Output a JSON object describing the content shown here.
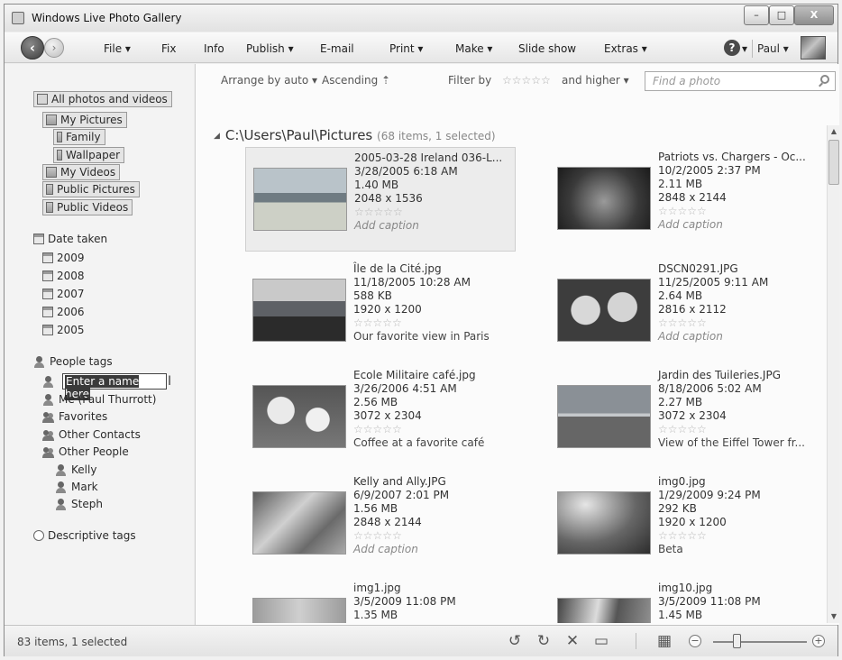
{
  "window": {
    "title": "Windows Live Photo Gallery",
    "min": "–",
    "max": "□",
    "close": "X"
  },
  "menubar": {
    "items": [
      {
        "label": "File ▾"
      },
      {
        "label": "Fix"
      },
      {
        "label": "Info"
      },
      {
        "label": "Publish ▾"
      },
      {
        "label": "E-mail"
      },
      {
        "label": "Print ▾"
      },
      {
        "label": "Make ▾"
      },
      {
        "label": "Slide show"
      },
      {
        "label": "Extras ▾"
      }
    ],
    "help": "?",
    "help_caret": "▾",
    "user": "Paul ▾"
  },
  "sidebar": {
    "all": "All photos and videos",
    "folders": [
      "My Pictures",
      "Family",
      "Wallpaper",
      "My Videos",
      "Public Pictures",
      "Public Videos"
    ],
    "date_taken": "Date taken",
    "years": [
      "2009",
      "2008",
      "2007",
      "2006",
      "2005"
    ],
    "people_tags": "People tags",
    "name_input": "Enter a name here",
    "people": [
      "Me (Paul Thurrott)",
      "Favorites",
      "Other Contacts",
      "Other People"
    ],
    "other_people": [
      "Kelly",
      "Mark",
      "Steph"
    ],
    "descriptive_tags": "Descriptive tags"
  },
  "toolbar": {
    "arrange": "Arrange by auto ▾",
    "order": "Ascending ⇡",
    "filter_label": "Filter by",
    "filter_stars": "☆☆☆☆☆",
    "filter_suffix": "and higher ▾",
    "search_placeholder": "Find a photo"
  },
  "path": {
    "label": "C:\\Users\\Paul\\Pictures",
    "count": "(68 items, 1 selected)"
  },
  "photos": [
    {
      "name": "2005-03-28 Ireland 036-L...",
      "date": "3/28/2005 6:18 AM",
      "size": "1.40 MB",
      "dims": "2048 x 1536",
      "rating": "☆☆☆☆☆",
      "caption": "Add caption"
    },
    {
      "name": "Patriots vs. Chargers - Oc...",
      "date": "10/2/2005 2:37 PM",
      "size": "2.11 MB",
      "dims": "2848 x 2144",
      "rating": "☆☆☆☆☆",
      "caption": "Add caption"
    },
    {
      "name": "Île de la Cité.jpg",
      "date": "11/18/2005 10:28 AM",
      "size": "588 KB",
      "dims": "1920 x 1200",
      "rating": "☆☆☆☆☆",
      "caption": "Our favorite view in Paris"
    },
    {
      "name": "DSCN0291.JPG",
      "date": "11/25/2005 9:11 AM",
      "size": "2.64 MB",
      "dims": "2816 x 2112",
      "rating": "☆☆☆☆☆",
      "caption": "Add caption"
    },
    {
      "name": "Ecole Militaire café.jpg",
      "date": "3/26/2006 4:51 AM",
      "size": "2.56 MB",
      "dims": "3072 x 2304",
      "rating": "☆☆☆☆☆",
      "caption": "Coffee at a favorite café"
    },
    {
      "name": "Jardin des Tuileries.JPG",
      "date": "8/18/2006 5:02 AM",
      "size": "2.27 MB",
      "dims": "3072 x 2304",
      "rating": "☆☆☆☆☆",
      "caption": "View of the Eiffel Tower fr..."
    },
    {
      "name": "Kelly and Ally.JPG",
      "date": "6/9/2007 2:01 PM",
      "size": "1.56 MB",
      "dims": "2848 x 2144",
      "rating": "☆☆☆☆☆",
      "caption": "Add caption"
    },
    {
      "name": "img0.jpg",
      "date": "1/29/2009 9:24 PM",
      "size": "292 KB",
      "dims": "1920 x 1200",
      "rating": "☆☆☆☆☆",
      "caption": "Beta"
    },
    {
      "name": "img1.jpg",
      "date": "3/5/2009 11:08 PM",
      "size": "1.35 MB",
      "dims": "",
      "rating": "",
      "caption": ""
    },
    {
      "name": "img10.jpg",
      "date": "3/5/2009 11:08 PM",
      "size": "1.45 MB",
      "dims": "",
      "rating": "",
      "caption": ""
    }
  ],
  "status": {
    "text": "83 items, 1 selected",
    "zoom_minus": "−",
    "zoom_plus": "+"
  },
  "colors": {
    "selection_bg": "#ececec",
    "chrome": "#eeeeee"
  }
}
